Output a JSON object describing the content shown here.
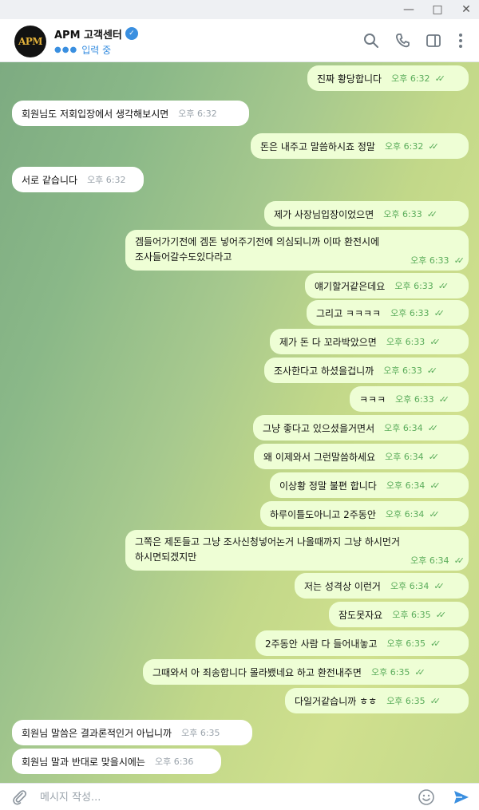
{
  "window": {
    "min_icon": "minimize-icon",
    "max_icon": "maximize-icon",
    "close_icon": "close-icon"
  },
  "header": {
    "avatar_text": "APM",
    "title": "APM 고객센터",
    "verified_icon": "verified-badge-icon",
    "status": "입력 중",
    "icons": [
      "search-icon",
      "phone-icon",
      "sidebar-toggle-icon",
      "more-vertical-icon"
    ]
  },
  "messages": [
    {
      "dir": "out",
      "lines": [
        "진짜 황당합니다"
      ],
      "time": "오후 6:32"
    },
    {
      "dir": "in",
      "lines": [
        "회원님도 저회입장에서 생각해보시면"
      ],
      "time": "오후 6:32"
    },
    {
      "dir": "out",
      "lines": [
        "돈은 내주고 말씀하시죠 정말"
      ],
      "time": "오후 6:32"
    },
    {
      "dir": "in",
      "lines": [
        "서로 같습니다"
      ],
      "time": "오후 6:32"
    },
    {
      "dir": "out",
      "lines": [
        "제가 사장님입장이었으면"
      ],
      "time": "오후 6:33"
    },
    {
      "dir": "out",
      "lines": [
        "겜들어가기전에 겜돈 넣어주기전에 의심되니까 이따 환전시에",
        "조사들어갈수도있다라고"
      ],
      "time": "오후 6:33"
    },
    {
      "dir": "out",
      "lines": [
        "얘기할거같은데요"
      ],
      "time": "오후 6:33"
    },
    {
      "dir": "out",
      "lines": [
        "그리고 ㅋㅋㅋㅋ"
      ],
      "time": "오후 6:33"
    },
    {
      "dir": "out",
      "lines": [
        "제가 돈 다 꼬라박았으면"
      ],
      "time": "오후 6:33"
    },
    {
      "dir": "out",
      "lines": [
        "조사한다고 하셨을겁니까"
      ],
      "time": "오후 6:33"
    },
    {
      "dir": "out",
      "lines": [
        "ㅋㅋㅋ"
      ],
      "time": "오후 6:33"
    },
    {
      "dir": "out",
      "lines": [
        "그냥 좋다고 있으셨을거면서"
      ],
      "time": "오후 6:34"
    },
    {
      "dir": "out",
      "lines": [
        "왜 이제와서 그런말씀하세요"
      ],
      "time": "오후 6:34"
    },
    {
      "dir": "out",
      "lines": [
        "이상황 정말 불편 합니다"
      ],
      "time": "오후 6:34"
    },
    {
      "dir": "out",
      "lines": [
        "하루이틀도아니고 2주동안"
      ],
      "time": "오후 6:34"
    },
    {
      "dir": "out",
      "lines": [
        "그쪽은 제돈들고 그냥 조사신청넣어논거 나올때까지 그냥 하시먼거",
        "하시면되겠지만"
      ],
      "time": "오후 6:34"
    },
    {
      "dir": "out",
      "lines": [
        "저는 성격상 이런거"
      ],
      "time": "오후 6:34"
    },
    {
      "dir": "out",
      "lines": [
        "잠도못자요"
      ],
      "time": "오후 6:35"
    },
    {
      "dir": "out",
      "lines": [
        "2주동안 사람 다 들어내놓고"
      ],
      "time": "오후 6:35"
    },
    {
      "dir": "out",
      "lines": [
        "그때와서 아 죄송합니다 몰라뵀네요 하고 환전내주면"
      ],
      "time": "오후 6:35"
    },
    {
      "dir": "out",
      "lines": [
        "다일거같습니까 ㅎㅎ"
      ],
      "time": "오후 6:35"
    },
    {
      "dir": "in",
      "lines": [
        "회원님 말씀은 결과론적인거 아닙니까"
      ],
      "time": "오후 6:35"
    },
    {
      "dir": "in",
      "lines": [
        "회원님 말과 반대로 맞을시에는"
      ],
      "time": "오후 6:36"
    }
  ],
  "composer": {
    "placeholder": "메시지 작성...",
    "value": "",
    "attach_icon": "paperclip-icon",
    "emoji_icon": "emoji-icon",
    "send_icon": "send-icon"
  }
}
